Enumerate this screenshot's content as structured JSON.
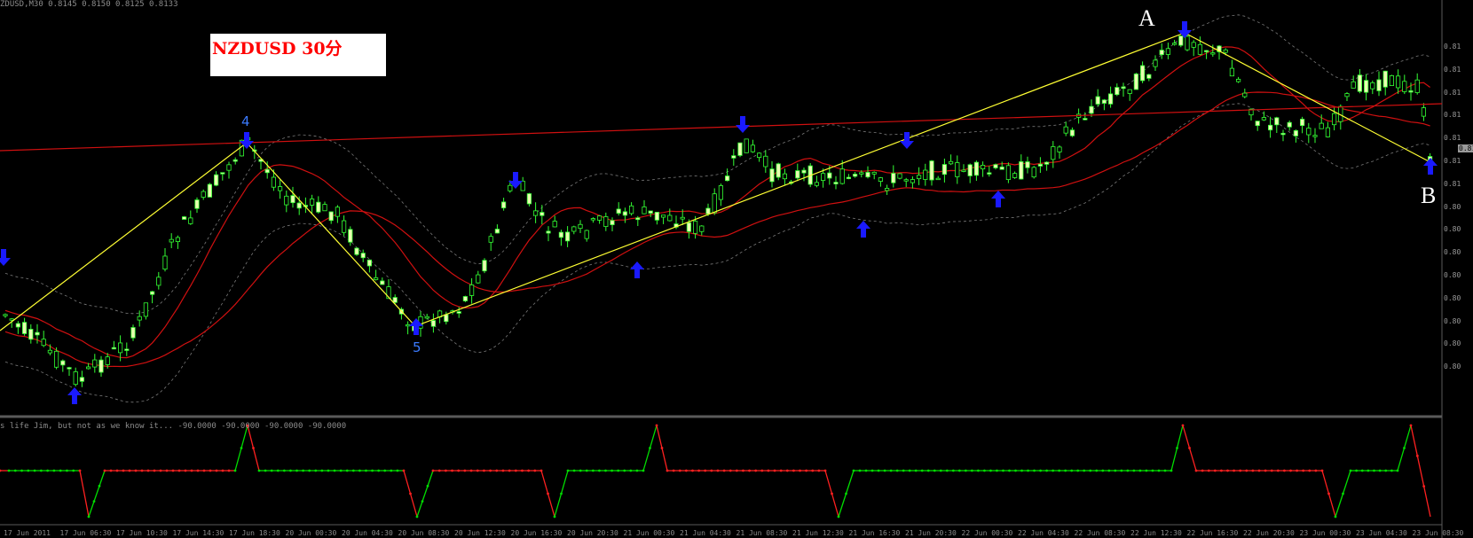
{
  "header": {
    "symbol_text": "ZDUSD,M30  0.8145 0.8150 0.8125 0.8133",
    "indicator_text": "s life Jim, but not as we know it...  -90.0000 -90.0000 -90.0000 -90.0000"
  },
  "title_box": {
    "text": "NZDUSD  30分",
    "background": "#ffffff",
    "color": "#ff0000"
  },
  "wave_labels": {
    "four": "4",
    "five": "5",
    "a": "A",
    "b": "B"
  },
  "price_axis": {
    "labels": [
      "0.81",
      "0.81",
      "0.81",
      "0.81",
      "0.81",
      "0.81",
      "0.81",
      "0.80",
      "0.80",
      "0.80",
      "0.80",
      "0.80",
      "0.80",
      "0.80",
      "0.80"
    ],
    "current": "0.81"
  },
  "time_axis": {
    "labels": [
      "17 Jun 2011",
      "17 Jun 06:30",
      "17 Jun 10:30",
      "17 Jun 14:30",
      "17 Jun 18:30",
      "20 Jun 00:30",
      "20 Jun 04:30",
      "20 Jun 08:30",
      "20 Jun 12:30",
      "20 Jun 16:30",
      "20 Jun 20:30",
      "21 Jun 00:30",
      "21 Jun 04:30",
      "21 Jun 08:30",
      "21 Jun 12:30",
      "21 Jun 16:30",
      "21 Jun 20:30",
      "22 Jun 00:30",
      "22 Jun 04:30",
      "22 Jun 08:30",
      "22 Jun 12:30",
      "22 Jun 16:30",
      "22 Jun 20:30",
      "23 Jun 00:30",
      "23 Jun 04:30",
      "23 Jun 08:30"
    ]
  },
  "colors": {
    "background": "#000000",
    "bull_candle": "#e8ffb0",
    "bear_candle": "#000000",
    "wick": "#33ff33",
    "moving_average": "#d01010",
    "bollinger": "#7a7a7a",
    "zigzag": "#ffff33",
    "arrows": "#1a1aff",
    "osc_up": "#00dd00",
    "osc_down": "#ff2020"
  },
  "icons": [
    "arrow-up-icon",
    "arrow-down-icon"
  ]
}
